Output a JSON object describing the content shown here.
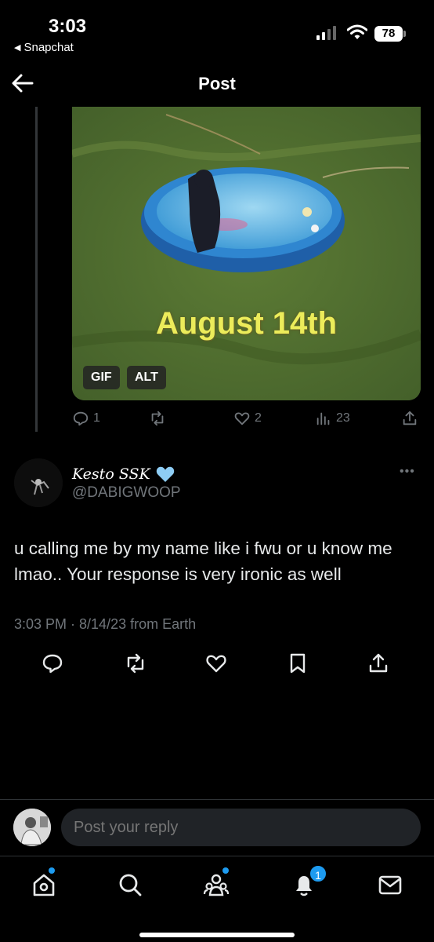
{
  "status_bar": {
    "time": "3:03",
    "back_app": "Snapchat",
    "battery": "78"
  },
  "header": {
    "title": "Post"
  },
  "media": {
    "caption": "August 14th",
    "gif_badge": "GIF",
    "alt_badge": "ALT"
  },
  "parent_actions": {
    "replies": "1",
    "likes": "2",
    "views": "23"
  },
  "reply_tweet": {
    "display_name": "Kesto SSK",
    "handle": "@DABIGWOOP",
    "text": "u calling me by my name like i fwu or u know me lmao.. Your response is very ironic as well",
    "meta": "3:03 PM · 8/14/23 from Earth"
  },
  "reply_box": {
    "placeholder": "Post your reply"
  },
  "tab_bar": {
    "notifications_count": "1"
  },
  "colors": {
    "accent": "#1d9bf0",
    "muted": "#71767b",
    "heart_emoji": "#8ecdf5"
  }
}
